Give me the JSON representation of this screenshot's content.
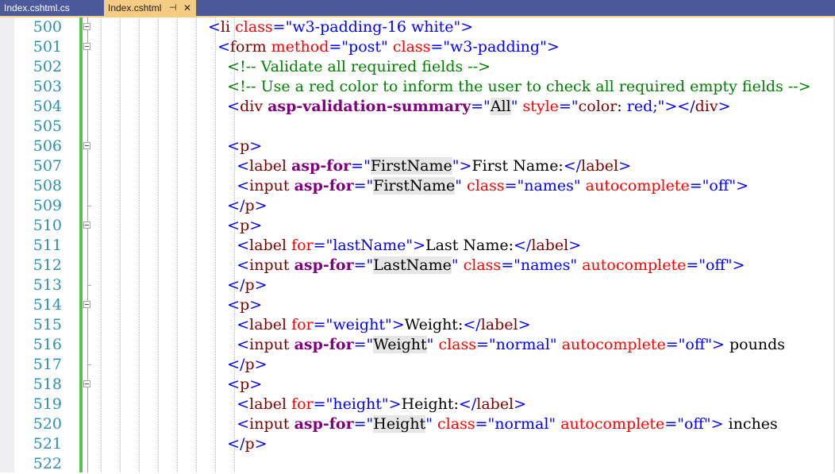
{
  "tabs": [
    {
      "label": "Index.cshtml.cs",
      "active": false
    },
    {
      "label": "Index.cshtml",
      "active": true,
      "pin_icon": "pin-icon",
      "close_glyph": "✕"
    }
  ],
  "colors": {
    "tabbar": "#4b5a9b",
    "active_tab": "#f5cc84",
    "line_number": "#2b91af",
    "tag_bracket": "#0000ff",
    "tag_name": "#800000",
    "attribute": "#ff0000",
    "value": "#0000ff",
    "comment": "#008000",
    "tag_helper": "#800080",
    "change_bar": "#57c14f"
  },
  "editor": {
    "lines": [
      {
        "number": "500",
        "fold": "start",
        "tokens": [
          {
            "t": "tv",
            "v": "<"
          },
          {
            "t": "tg",
            "v": "li"
          },
          {
            "t": "tt",
            "v": " "
          },
          {
            "t": "at",
            "v": "class"
          },
          {
            "t": "tv",
            "v": "=\"w3-padding-16 white\">"
          }
        ]
      },
      {
        "number": "501",
        "fold": "start",
        "tokens": [
          {
            "t": "tt",
            "v": "  "
          },
          {
            "t": "tv",
            "v": "<"
          },
          {
            "t": "tg",
            "v": "form"
          },
          {
            "t": "tt",
            "v": " "
          },
          {
            "t": "at",
            "v": "method"
          },
          {
            "t": "tv",
            "v": "=\"post\""
          },
          {
            "t": "tt",
            "v": " "
          },
          {
            "t": "at",
            "v": "class"
          },
          {
            "t": "tv",
            "v": "=\"w3-padding\">"
          }
        ]
      },
      {
        "number": "502",
        "fold": "",
        "tokens": [
          {
            "t": "tt",
            "v": "    "
          },
          {
            "t": "tc",
            "v": "<!-- Validate all required fields -->"
          }
        ]
      },
      {
        "number": "503",
        "fold": "",
        "tokens": [
          {
            "t": "tt",
            "v": "    "
          },
          {
            "t": "tc",
            "v": "<!-- Use a red color to inform the user to check all required empty fields -->"
          }
        ]
      },
      {
        "number": "504",
        "fold": "",
        "tokens": [
          {
            "t": "tt",
            "v": "    "
          },
          {
            "t": "tv",
            "v": "<"
          },
          {
            "t": "tg",
            "v": "div"
          },
          {
            "t": "tt",
            "v": " "
          },
          {
            "t": "ta",
            "v": "asp-validation-summary"
          },
          {
            "t": "tv",
            "v": "=\""
          },
          {
            "t": "hl",
            "v": "All"
          },
          {
            "t": "tv",
            "v": "\""
          },
          {
            "t": "tt",
            "v": " "
          },
          {
            "t": "at",
            "v": "style"
          },
          {
            "t": "tv",
            "v": "=\""
          },
          {
            "t": "tg",
            "v": "color"
          },
          {
            "t": "tt",
            "v": ": "
          },
          {
            "t": "tv",
            "v": "red;\"></"
          },
          {
            "t": "tg",
            "v": "div"
          },
          {
            "t": "tv",
            "v": ">"
          }
        ]
      },
      {
        "number": "505",
        "fold": "",
        "tokens": []
      },
      {
        "number": "506",
        "fold": "start",
        "tokens": [
          {
            "t": "tt",
            "v": "    "
          },
          {
            "t": "tv",
            "v": "<"
          },
          {
            "t": "tg",
            "v": "p"
          },
          {
            "t": "tv",
            "v": ">"
          }
        ]
      },
      {
        "number": "507",
        "fold": "",
        "tokens": [
          {
            "t": "tt",
            "v": "      "
          },
          {
            "t": "tv",
            "v": "<"
          },
          {
            "t": "tg",
            "v": "label"
          },
          {
            "t": "tt",
            "v": " "
          },
          {
            "t": "ta",
            "v": "asp-for"
          },
          {
            "t": "tv",
            "v": "=\""
          },
          {
            "t": "hl",
            "v": "FirstName"
          },
          {
            "t": "tv",
            "v": "\">"
          },
          {
            "t": "tt",
            "v": "First Name:"
          },
          {
            "t": "tv",
            "v": "</"
          },
          {
            "t": "tg",
            "v": "label"
          },
          {
            "t": "tv",
            "v": ">"
          }
        ]
      },
      {
        "number": "508",
        "fold": "",
        "tokens": [
          {
            "t": "tt",
            "v": "      "
          },
          {
            "t": "tv",
            "v": "<"
          },
          {
            "t": "tg",
            "v": "input"
          },
          {
            "t": "tt",
            "v": " "
          },
          {
            "t": "ta",
            "v": "asp-for"
          },
          {
            "t": "tv",
            "v": "=\""
          },
          {
            "t": "hl",
            "v": "FirstName"
          },
          {
            "t": "tv",
            "v": "\""
          },
          {
            "t": "tt",
            "v": " "
          },
          {
            "t": "at",
            "v": "class"
          },
          {
            "t": "tv",
            "v": "=\"names\""
          },
          {
            "t": "tt",
            "v": " "
          },
          {
            "t": "at",
            "v": "autocomplete"
          },
          {
            "t": "tv",
            "v": "=\"off\">"
          }
        ]
      },
      {
        "number": "509",
        "fold": "end",
        "tokens": [
          {
            "t": "tt",
            "v": "    "
          },
          {
            "t": "tv",
            "v": "</"
          },
          {
            "t": "tg",
            "v": "p"
          },
          {
            "t": "tv",
            "v": ">"
          }
        ]
      },
      {
        "number": "510",
        "fold": "start",
        "tokens": [
          {
            "t": "tt",
            "v": "    "
          },
          {
            "t": "tv",
            "v": "<"
          },
          {
            "t": "tg",
            "v": "p"
          },
          {
            "t": "tv",
            "v": ">"
          }
        ]
      },
      {
        "number": "511",
        "fold": "",
        "tokens": [
          {
            "t": "tt",
            "v": "      "
          },
          {
            "t": "tv",
            "v": "<"
          },
          {
            "t": "tg",
            "v": "label"
          },
          {
            "t": "tt",
            "v": " "
          },
          {
            "t": "at",
            "v": "for"
          },
          {
            "t": "tv",
            "v": "=\"lastName\">"
          },
          {
            "t": "tt",
            "v": "Last Name:"
          },
          {
            "t": "tv",
            "v": "</"
          },
          {
            "t": "tg",
            "v": "label"
          },
          {
            "t": "tv",
            "v": ">"
          }
        ]
      },
      {
        "number": "512",
        "fold": "",
        "tokens": [
          {
            "t": "tt",
            "v": "      "
          },
          {
            "t": "tv",
            "v": "<"
          },
          {
            "t": "tg",
            "v": "input"
          },
          {
            "t": "tt",
            "v": " "
          },
          {
            "t": "ta",
            "v": "asp-for"
          },
          {
            "t": "tv",
            "v": "=\""
          },
          {
            "t": "hl",
            "v": "LastName"
          },
          {
            "t": "tv",
            "v": "\""
          },
          {
            "t": "tt",
            "v": " "
          },
          {
            "t": "at",
            "v": "class"
          },
          {
            "t": "tv",
            "v": "=\"names\""
          },
          {
            "t": "tt",
            "v": " "
          },
          {
            "t": "at",
            "v": "autocomplete"
          },
          {
            "t": "tv",
            "v": "=\"off\">"
          }
        ]
      },
      {
        "number": "513",
        "fold": "end",
        "tokens": [
          {
            "t": "tt",
            "v": "    "
          },
          {
            "t": "tv",
            "v": "</"
          },
          {
            "t": "tg",
            "v": "p"
          },
          {
            "t": "tv",
            "v": ">"
          }
        ]
      },
      {
        "number": "514",
        "fold": "start",
        "tokens": [
          {
            "t": "tt",
            "v": "    "
          },
          {
            "t": "tv",
            "v": "<"
          },
          {
            "t": "tg",
            "v": "p"
          },
          {
            "t": "tv",
            "v": ">"
          }
        ]
      },
      {
        "number": "515",
        "fold": "",
        "tokens": [
          {
            "t": "tt",
            "v": "      "
          },
          {
            "t": "tv",
            "v": "<"
          },
          {
            "t": "tg",
            "v": "label"
          },
          {
            "t": "tt",
            "v": " "
          },
          {
            "t": "at",
            "v": "for"
          },
          {
            "t": "tv",
            "v": "=\"weight\">"
          },
          {
            "t": "tt",
            "v": "Weight:"
          },
          {
            "t": "tv",
            "v": "</"
          },
          {
            "t": "tg",
            "v": "label"
          },
          {
            "t": "tv",
            "v": ">"
          }
        ]
      },
      {
        "number": "516",
        "fold": "",
        "tokens": [
          {
            "t": "tt",
            "v": "      "
          },
          {
            "t": "tv",
            "v": "<"
          },
          {
            "t": "tg",
            "v": "input"
          },
          {
            "t": "tt",
            "v": " "
          },
          {
            "t": "ta",
            "v": "asp-for"
          },
          {
            "t": "tv",
            "v": "=\""
          },
          {
            "t": "hl",
            "v": "Weight"
          },
          {
            "t": "tv",
            "v": "\""
          },
          {
            "t": "tt",
            "v": " "
          },
          {
            "t": "at",
            "v": "class"
          },
          {
            "t": "tv",
            "v": "=\"normal\""
          },
          {
            "t": "tt",
            "v": " "
          },
          {
            "t": "at",
            "v": "autocomplete"
          },
          {
            "t": "tv",
            "v": "=\"off\">"
          },
          {
            "t": "tt",
            "v": " pounds"
          }
        ]
      },
      {
        "number": "517",
        "fold": "end",
        "tokens": [
          {
            "t": "tt",
            "v": "    "
          },
          {
            "t": "tv",
            "v": "</"
          },
          {
            "t": "tg",
            "v": "p"
          },
          {
            "t": "tv",
            "v": ">"
          }
        ]
      },
      {
        "number": "518",
        "fold": "start",
        "tokens": [
          {
            "t": "tt",
            "v": "    "
          },
          {
            "t": "tv",
            "v": "<"
          },
          {
            "t": "tg",
            "v": "p"
          },
          {
            "t": "tv",
            "v": ">"
          }
        ]
      },
      {
        "number": "519",
        "fold": "",
        "tokens": [
          {
            "t": "tt",
            "v": "      "
          },
          {
            "t": "tv",
            "v": "<"
          },
          {
            "t": "tg",
            "v": "label"
          },
          {
            "t": "tt",
            "v": " "
          },
          {
            "t": "at",
            "v": "for"
          },
          {
            "t": "tv",
            "v": "=\"height\">"
          },
          {
            "t": "tt",
            "v": "Height:"
          },
          {
            "t": "tv",
            "v": "</"
          },
          {
            "t": "tg",
            "v": "label"
          },
          {
            "t": "tv",
            "v": ">"
          }
        ]
      },
      {
        "number": "520",
        "fold": "",
        "tokens": [
          {
            "t": "tt",
            "v": "      "
          },
          {
            "t": "tv",
            "v": "<"
          },
          {
            "t": "tg",
            "v": "input"
          },
          {
            "t": "tt",
            "v": " "
          },
          {
            "t": "ta",
            "v": "asp-for"
          },
          {
            "t": "tv",
            "v": "=\""
          },
          {
            "t": "hl",
            "v": "Height"
          },
          {
            "t": "tv",
            "v": "\""
          },
          {
            "t": "tt",
            "v": " "
          },
          {
            "t": "at",
            "v": "class"
          },
          {
            "t": "tv",
            "v": "=\"normal\""
          },
          {
            "t": "tt",
            "v": " "
          },
          {
            "t": "at",
            "v": "autocomplete"
          },
          {
            "t": "tv",
            "v": "=\"off\">"
          },
          {
            "t": "tt",
            "v": " inches"
          }
        ]
      },
      {
        "number": "521",
        "fold": "",
        "tokens": [
          {
            "t": "tt",
            "v": "    "
          },
          {
            "t": "tv",
            "v": "</"
          },
          {
            "t": "tg",
            "v": "p"
          },
          {
            "t": "tv",
            "v": ">"
          }
        ]
      },
      {
        "number": "522",
        "fold": "",
        "tokens": []
      }
    ]
  }
}
